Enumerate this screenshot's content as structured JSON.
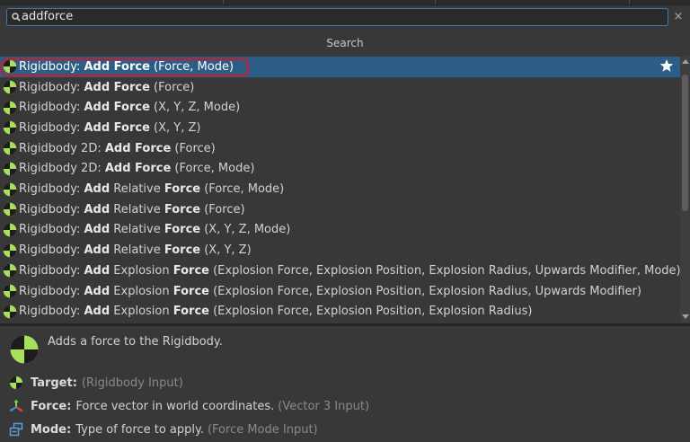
{
  "search": {
    "query": "addforce",
    "clear_glyph": "×"
  },
  "list_header": "Search",
  "results": [
    {
      "prefix": "Rigidbody: ",
      "b1": "Add Force",
      "mid": "",
      "b2": "",
      "params": " (Force, Mode)",
      "selected": true,
      "favorite": true
    },
    {
      "prefix": "Rigidbody: ",
      "b1": "Add Force",
      "mid": "",
      "b2": "",
      "params": " (Force)"
    },
    {
      "prefix": "Rigidbody: ",
      "b1": "Add Force",
      "mid": "",
      "b2": "",
      "params": " (X, Y, Z, Mode)"
    },
    {
      "prefix": "Rigidbody: ",
      "b1": "Add Force",
      "mid": "",
      "b2": "",
      "params": " (X, Y, Z)"
    },
    {
      "prefix": "Rigidbody 2D: ",
      "b1": "Add Force",
      "mid": "",
      "b2": "",
      "params": " (Force)"
    },
    {
      "prefix": "Rigidbody 2D: ",
      "b1": "Add Force",
      "mid": "",
      "b2": "",
      "params": " (Force, Mode)"
    },
    {
      "prefix": "Rigidbody: ",
      "b1": "Add",
      "mid": " Relative ",
      "b2": "Force",
      "params": " (Force, Mode)"
    },
    {
      "prefix": "Rigidbody: ",
      "b1": "Add",
      "mid": " Relative ",
      "b2": "Force",
      "params": " (Force)"
    },
    {
      "prefix": "Rigidbody: ",
      "b1": "Add",
      "mid": " Relative ",
      "b2": "Force",
      "params": " (X, Y, Z, Mode)"
    },
    {
      "prefix": "Rigidbody: ",
      "b1": "Add",
      "mid": " Relative ",
      "b2": "Force",
      "params": " (X, Y, Z)"
    },
    {
      "prefix": "Rigidbody: ",
      "b1": "Add",
      "mid": " Explosion ",
      "b2": "Force",
      "params": " (Explosion Force, Explosion Position, Explosion Radius, Upwards Modifier, Mode)"
    },
    {
      "prefix": "Rigidbody: ",
      "b1": "Add",
      "mid": " Explosion ",
      "b2": "Force",
      "params": " (Explosion Force, Explosion Position, Explosion Radius, Upwards Modifier)"
    },
    {
      "prefix": "Rigidbody: ",
      "b1": "Add",
      "mid": " Explosion ",
      "b2": "Force",
      "params": " (Explosion Force, Explosion Position, Explosion Radius)"
    }
  ],
  "details": {
    "description": "Adds a force to the Rigidbody.",
    "ports": [
      {
        "icon": "rigidbody-port-icon",
        "name": "Target:",
        "desc": "",
        "type": "(Rigidbody Input)"
      },
      {
        "icon": "vector3-axes-icon",
        "name": "Force:",
        "desc": "Force vector in world coordinates.",
        "type": "(Vector 3 Input)"
      },
      {
        "icon": "enum-icon",
        "name": "Mode:",
        "desc": "Type of force to apply.",
        "type": "(Force Mode Input)"
      }
    ]
  },
  "colors": {
    "selection": "#2c5d87",
    "focus_ring": "#d01a2a",
    "icon_green": "#a8e05a",
    "search_border": "#3a79bb"
  }
}
